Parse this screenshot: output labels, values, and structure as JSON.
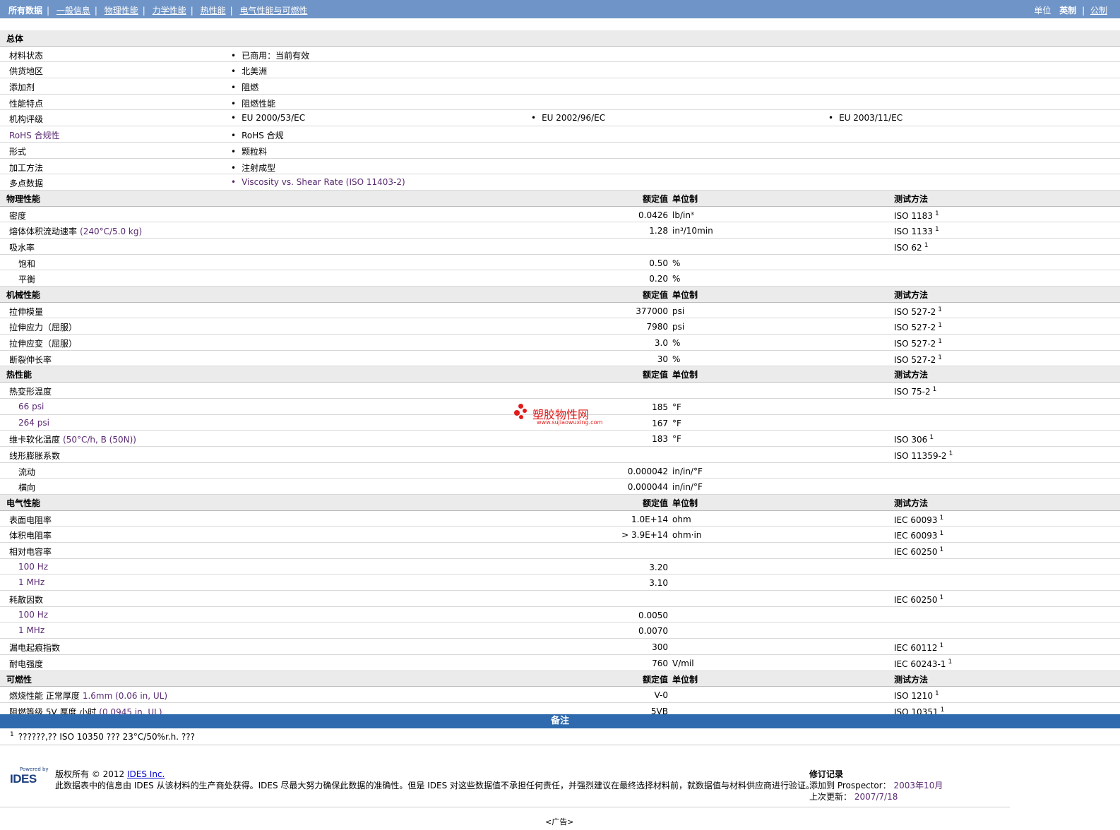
{
  "nav": {
    "items": [
      "所有数据",
      "一般信息",
      "物理性能",
      "力学性能",
      "热性能",
      "电气性能与可燃性"
    ],
    "units_label": "单位",
    "unit_imperial": "英制",
    "unit_metric": "公制"
  },
  "general": {
    "title": "总体",
    "rows": [
      {
        "label": "材料状态",
        "values": [
          "已商用：当前有效"
        ]
      },
      {
        "label": "供货地区",
        "values": [
          "北美洲"
        ]
      },
      {
        "label": "添加剂",
        "values": [
          "阻燃"
        ]
      },
      {
        "label": "性能特点",
        "values": [
          "阻燃性能"
        ]
      },
      {
        "label": "机构评级",
        "values": [
          "EU 2000/53/EC",
          "EU 2002/96/EC",
          "EU 2003/11/EC"
        ]
      },
      {
        "label": "RoHS 合规性",
        "values": [
          "RoHS 合规"
        ]
      },
      {
        "label": "形式",
        "values": [
          "颗粒料"
        ]
      },
      {
        "label": "加工方法",
        "values": [
          "注射成型"
        ]
      },
      {
        "label": "多点数据",
        "values": [
          "Viscosity vs. Shear Rate (ISO 11403-2)"
        ]
      }
    ]
  },
  "headers": {
    "value": "额定值",
    "unit": "单位制",
    "method": "测试方法"
  },
  "sections": [
    {
      "title": "物理性能",
      "rows": [
        {
          "label": "密度",
          "value": "0.0426",
          "unit": "lb/in³",
          "method": "ISO 1183",
          "sup": "1"
        },
        {
          "label": "熔体体积流动速率",
          "note": "(240°C/5.0 kg)",
          "value": "1.28",
          "unit": "in³/10min",
          "method": "ISO 1133",
          "sup": "1"
        },
        {
          "label": "吸水率",
          "value": "",
          "unit": "",
          "method": "ISO 62",
          "sup": "1"
        },
        {
          "label": "饱和",
          "sub": true,
          "value": "0.50",
          "unit": "%",
          "method": "",
          "sup": ""
        },
        {
          "label": "平衡",
          "sub": true,
          "value": "0.20",
          "unit": "%",
          "method": "",
          "sup": ""
        }
      ]
    },
    {
      "title": "机械性能",
      "rows": [
        {
          "label": "拉伸模量",
          "value": "377000",
          "unit": "psi",
          "method": "ISO 527-2",
          "sup": "1"
        },
        {
          "label": "拉伸应力（屈服）",
          "value": "7980",
          "unit": "psi",
          "method": "ISO 527-2",
          "sup": "1"
        },
        {
          "label": "拉伸应变（屈服）",
          "value": "3.0",
          "unit": "%",
          "method": "ISO 527-2",
          "sup": "1"
        },
        {
          "label": "断裂伸长率",
          "value": "30",
          "unit": "%",
          "method": "ISO 527-2",
          "sup": "1"
        }
      ]
    },
    {
      "title": "热性能",
      "rows": [
        {
          "label": "热变形温度",
          "value": "",
          "unit": "",
          "method": "ISO 75-2",
          "sup": "1"
        },
        {
          "label": "66 psi",
          "sub": true,
          "purple": true,
          "value": "185",
          "unit": "°F",
          "method": "",
          "sup": ""
        },
        {
          "label": "264 psi",
          "sub": true,
          "purple": true,
          "value": "167",
          "unit": "°F",
          "method": "",
          "sup": ""
        },
        {
          "label": "维卡软化温度",
          "note": "(50°C/h, B (50N))",
          "value": "183",
          "unit": "°F",
          "method": "ISO 306",
          "sup": "1"
        },
        {
          "label": "线形膨胀系数",
          "value": "",
          "unit": "",
          "method": "ISO 11359-2",
          "sup": "1"
        },
        {
          "label": "流动",
          "sub": true,
          "value": "0.000042",
          "unit": "in/in/°F",
          "method": "",
          "sup": ""
        },
        {
          "label": "横向",
          "sub": true,
          "value": "0.000044",
          "unit": "in/in/°F",
          "method": "",
          "sup": ""
        }
      ]
    },
    {
      "title": "电气性能",
      "rows": [
        {
          "label": "表面电阻率",
          "value": "1.0E+14",
          "unit": "ohm",
          "method": "IEC 60093",
          "sup": "1"
        },
        {
          "label": "体积电阻率",
          "value": "> 3.9E+14",
          "unit": "ohm·in",
          "method": "IEC 60093",
          "sup": "1"
        },
        {
          "label": "相对电容率",
          "value": "",
          "unit": "",
          "method": "IEC 60250",
          "sup": "1"
        },
        {
          "label": "100 Hz",
          "sub": true,
          "purple": true,
          "value": "3.20",
          "unit": "",
          "method": "",
          "sup": ""
        },
        {
          "label": "1 MHz",
          "sub": true,
          "purple": true,
          "value": "3.10",
          "unit": "",
          "method": "",
          "sup": ""
        },
        {
          "label": "耗散因数",
          "value": "",
          "unit": "",
          "method": "IEC 60250",
          "sup": "1"
        },
        {
          "label": "100 Hz",
          "sub": true,
          "purple": true,
          "value": "0.0050",
          "unit": "",
          "method": "",
          "sup": ""
        },
        {
          "label": "1 MHz",
          "sub": true,
          "purple": true,
          "value": "0.0070",
          "unit": "",
          "method": "",
          "sup": ""
        },
        {
          "label": "漏电起痕指数",
          "value": "300",
          "unit": "",
          "method": "IEC 60112",
          "sup": "1"
        },
        {
          "label": "耐电强度",
          "value": "760",
          "unit": "V/mil",
          "method": "IEC 60243-1",
          "sup": "1"
        }
      ]
    },
    {
      "title": "可燃性",
      "rows": [
        {
          "label": "燃烧性能  正常厚度",
          "note": "1.6mm (0.06 in, UL)",
          "value": "V-0",
          "unit": "",
          "method": "ISO 1210",
          "sup": "1"
        },
        {
          "label": "阻燃等级  5V 厚度  小时",
          "note": "(0.0945 in, UL)",
          "value": "5VB",
          "unit": "",
          "method": "ISO 10351",
          "sup": "1"
        }
      ]
    }
  ],
  "notes": {
    "title": "备注",
    "footnote_mark": "1",
    "footnote_text": "??????,?? ISO 10350 ??? 23°C/50%r.h. ???"
  },
  "watermark": {
    "text": "塑胶物性网",
    "url": "www.sujiaowuxing.com"
  },
  "footer": {
    "logo_powered": "Powered by",
    "logo_text": "IDES",
    "copyright_prefix": "版权所有 © 2012",
    "copyright_link": "IDES Inc.",
    "disclaimer": "此数据表中的信息由 IDES 从该材料的生产商处获得。IDES 尽最大努力确保此数据的准确性。但是 IDES 对这些数据值不承担任何责任，并强烈建议在最终选择材料前，就数据值与材料供应商进行验证。",
    "rev_title": "修订记录",
    "added_label": "添加到 Prospector：",
    "added_value": "2003年10月",
    "updated_label": "上次更新：",
    "updated_value": "2007/7/18",
    "ad": "<广告>"
  }
}
